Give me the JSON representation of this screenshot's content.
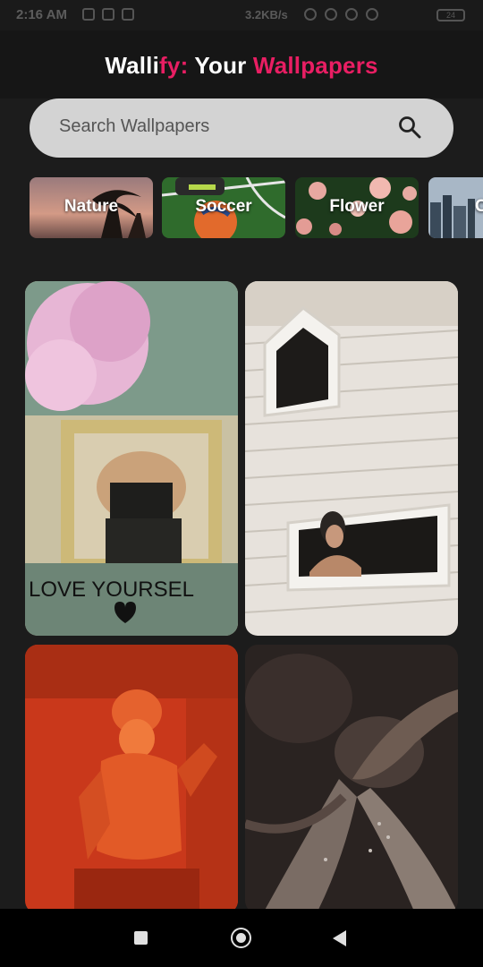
{
  "status": {
    "time": "2:16 AM",
    "speed": "3.2KB/s",
    "battery": "24"
  },
  "app": {
    "title_part1": "Walli",
    "title_part2": "fy:",
    "title_part3": " Your ",
    "title_part4": "Wallpapers",
    "accent": "#e91e63"
  },
  "search": {
    "placeholder": "Search Wallpapers",
    "icon": "search-icon"
  },
  "categories": [
    {
      "label": "Nature"
    },
    {
      "label": "Soccer"
    },
    {
      "label": "Flower"
    },
    {
      "label": "C"
    }
  ],
  "wallpapers": [
    {
      "caption": "LOVE YOURSEL"
    },
    {
      "caption": ""
    },
    {
      "caption": ""
    },
    {
      "caption": ""
    }
  ],
  "navbar": {
    "icons": [
      "square-icon",
      "home-circle-icon",
      "back-triangle-icon"
    ]
  }
}
